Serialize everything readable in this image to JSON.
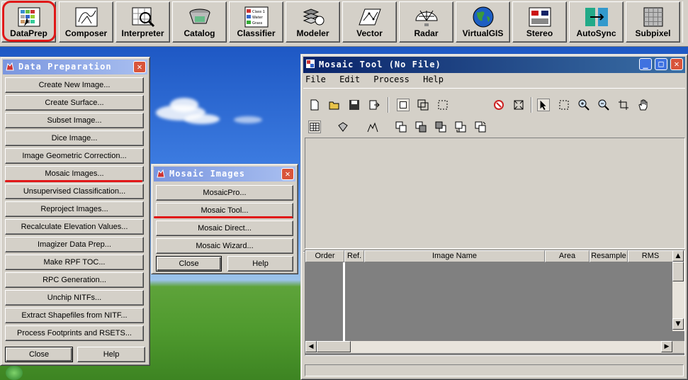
{
  "toolbar": {
    "items": [
      {
        "label": "DataPrep",
        "icon": "dataprep-icon"
      },
      {
        "label": "Composer",
        "icon": "composer-icon"
      },
      {
        "label": "Interpreter",
        "icon": "interpreter-icon"
      },
      {
        "label": "Catalog",
        "icon": "catalog-icon"
      },
      {
        "label": "Classifier",
        "icon": "classifier-icon"
      },
      {
        "label": "Modeler",
        "icon": "modeler-icon"
      },
      {
        "label": "Vector",
        "icon": "vector-icon"
      },
      {
        "label": "Radar",
        "icon": "radar-icon"
      },
      {
        "label": "VirtualGIS",
        "icon": "globe-icon"
      },
      {
        "label": "Stereo",
        "icon": "stereo-icon"
      },
      {
        "label": "AutoSync",
        "icon": "autosync-icon"
      },
      {
        "label": "Subpixel",
        "icon": "subpixel-icon"
      }
    ],
    "classifier_legend": [
      "Class 1",
      "Water",
      "Grass"
    ]
  },
  "data_prep": {
    "title": "Data Preparation",
    "buttons": [
      "Create New Image...",
      "Create Surface...",
      "Subset Image...",
      "Dice Image...",
      "Image Geometric Correction...",
      "Mosaic Images...",
      "Unsupervised Classification...",
      "Reproject Images...",
      "Recalculate Elevation Values...",
      "Imagizer Data Prep...",
      "Make RPF TOC...",
      "RPC Generation...",
      "Unchip NITFs...",
      "Extract Shapefiles from NITF...",
      "Process Footprints and RSETS..."
    ],
    "close_label": "Close",
    "help_label": "Help"
  },
  "mosaic_images": {
    "title": "Mosaic Images",
    "buttons": [
      "MosaicPro...",
      "Mosaic Tool...",
      "Mosaic Direct...",
      "Mosaic Wizard..."
    ],
    "close_label": "Close",
    "help_label": "Help"
  },
  "mosaic_tool": {
    "title": "Mosaic Tool (No File)",
    "menu": [
      "File",
      "Edit",
      "Process",
      "Help"
    ],
    "columns": [
      "Order",
      "Ref.",
      "Image Name",
      "Area",
      "Resample",
      "RMS"
    ]
  },
  "colors": {
    "highlight": "#e01818",
    "window_face": "#d4d0c8",
    "active_title": "#0a246a",
    "inactive_title": "#7a96df"
  }
}
